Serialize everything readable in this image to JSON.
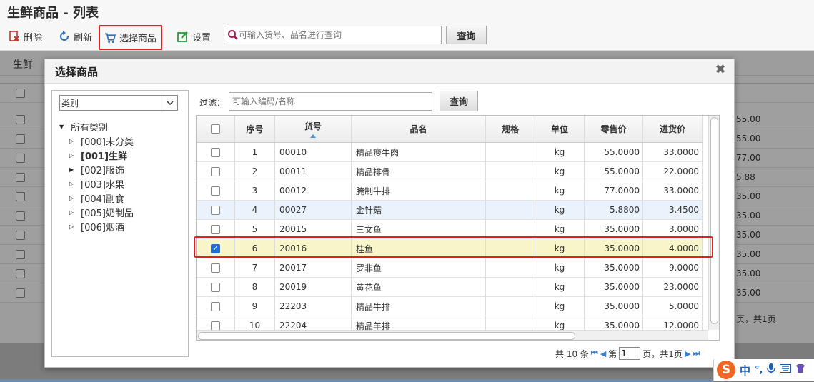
{
  "page": {
    "title": "生鲜商品 - 列表"
  },
  "toolbar": {
    "delete_label": "删除",
    "refresh_label": "刷新",
    "select_label": "选择商品",
    "settings_label": "设置",
    "search_placeholder": "可输入货号、品名进行查询",
    "query_label": "查询"
  },
  "background": {
    "tab_label": "生鲜",
    "row_values": [
      "55.00",
      "55.00",
      "77.00",
      "5.88",
      "35.00",
      "35.00",
      "35.00",
      "35.00",
      "35.00",
      "35.00"
    ],
    "pager_text": "页，共1页"
  },
  "dialog": {
    "title": "选择商品",
    "category_select": "类别",
    "tree": {
      "root": "所有类别",
      "children": [
        "[000]未分类",
        "[001]生鲜",
        "[002]服饰",
        "[003]水果",
        "[004]副食",
        "[005]奶制品",
        "[006]烟酒"
      ]
    },
    "filter_label": "过滤：",
    "filter_placeholder": "可输入编码/名称",
    "query_label": "查询",
    "columns": [
      "序号",
      "货号",
      "品名",
      "规格",
      "单位",
      "零售价",
      "进货价"
    ],
    "rows": [
      {
        "no": "1",
        "code": "00010",
        "name": "精品瘦牛肉",
        "spec": "",
        "unit": "kg",
        "retail": "55.0000",
        "cost": "33.0000",
        "checked": false
      },
      {
        "no": "2",
        "code": "00011",
        "name": "精品排骨",
        "spec": "",
        "unit": "kg",
        "retail": "55.0000",
        "cost": "22.0000",
        "checked": false
      },
      {
        "no": "3",
        "code": "00012",
        "name": "腌制牛排",
        "spec": "",
        "unit": "kg",
        "retail": "77.0000",
        "cost": "33.0000",
        "checked": false
      },
      {
        "no": "4",
        "code": "00027",
        "name": "金针菇",
        "spec": "",
        "unit": "kg",
        "retail": "5.8800",
        "cost": "3.4500",
        "checked": false
      },
      {
        "no": "5",
        "code": "20015",
        "name": "三文鱼",
        "spec": "",
        "unit": "kg",
        "retail": "35.0000",
        "cost": "3.0000",
        "checked": false
      },
      {
        "no": "6",
        "code": "20016",
        "name": "桂鱼",
        "spec": "",
        "unit": "kg",
        "retail": "35.0000",
        "cost": "4.0000",
        "checked": true
      },
      {
        "no": "7",
        "code": "20017",
        "name": "罗非鱼",
        "spec": "",
        "unit": "kg",
        "retail": "35.0000",
        "cost": "9.0000",
        "checked": false
      },
      {
        "no": "8",
        "code": "20019",
        "name": "黄花鱼",
        "spec": "",
        "unit": "kg",
        "retail": "35.0000",
        "cost": "23.0000",
        "checked": false
      },
      {
        "no": "9",
        "code": "22203",
        "name": "精品牛排",
        "spec": "",
        "unit": "kg",
        "retail": "35.0000",
        "cost": "5.0000",
        "checked": false
      },
      {
        "no": "10",
        "code": "22204",
        "name": "精品羊排",
        "spec": "",
        "unit": "kg",
        "retail": "35.0000",
        "cost": "12.0000",
        "checked": false
      }
    ],
    "pager": {
      "total": "共 10 条",
      "page_prefix": "第",
      "page_value": "1",
      "page_suffix": "页，共1页"
    }
  },
  "ime": {
    "lang": "中",
    "punct": "°,"
  },
  "colors": {
    "highlight_border": "#e02020",
    "selected_row": "#f8f6c8",
    "hover_row": "#eaf2fc",
    "accent_blue": "#3a7fd0"
  }
}
